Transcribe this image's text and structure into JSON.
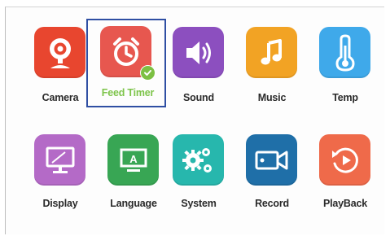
{
  "menu": {
    "items": [
      {
        "key": "camera",
        "label": "Camera",
        "icon": "camera-icon",
        "color": "#e8462f"
      },
      {
        "key": "feed-timer",
        "label": "Feed Timer",
        "icon": "alarm-clock-icon",
        "color": "#e7574f",
        "selected": true,
        "label_color": "#7dc44a"
      },
      {
        "key": "sound",
        "label": "Sound",
        "icon": "speaker-icon",
        "color": "#8c4fbf"
      },
      {
        "key": "music",
        "label": "Music",
        "icon": "music-note-icon",
        "color": "#f2a324"
      },
      {
        "key": "temp",
        "label": "Temp",
        "icon": "thermometer-icon",
        "color": "#3fa9ea"
      },
      {
        "key": "display",
        "label": "Display",
        "icon": "monitor-icon",
        "color": "#b46ac7"
      },
      {
        "key": "language",
        "label": "Language",
        "icon": "language-board-icon",
        "color": "#38a654"
      },
      {
        "key": "system",
        "label": "System",
        "icon": "gears-icon",
        "color": "#27b7ad"
      },
      {
        "key": "record",
        "label": "Record",
        "icon": "video-camera-icon",
        "color": "#1f6fa8"
      },
      {
        "key": "playback",
        "label": "PlayBack",
        "icon": "replay-icon",
        "color": "#ef6a4a"
      }
    ],
    "selection_border_color": "#2f4fa3",
    "selected_badge": "check-icon"
  },
  "icon_glyphs": {
    "language": "A"
  }
}
